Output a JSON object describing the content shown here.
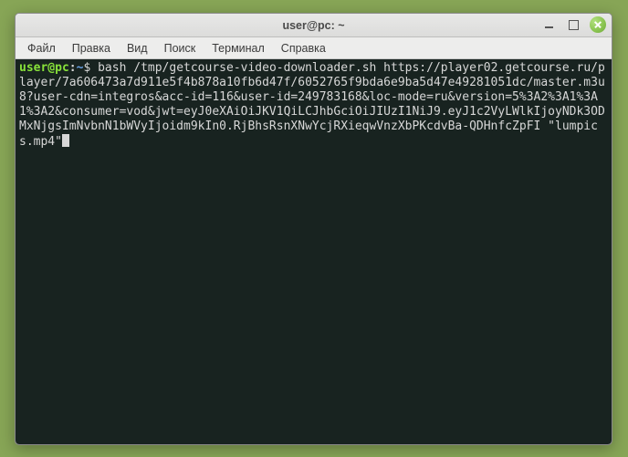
{
  "window": {
    "title": "user@pc: ~"
  },
  "menu": {
    "items": [
      "Файл",
      "Правка",
      "Вид",
      "Поиск",
      "Терминал",
      "Справка"
    ]
  },
  "prompt": {
    "user": "user@pc",
    "colon": ":",
    "path": "~",
    "dollar": "$ "
  },
  "terminal": {
    "command": "bash /tmp/getcourse-video-downloader.sh https://player02.getcourse.ru/player/7a606473a7d911e5f4b878a10fb6d47f/6052765f9bda6e9ba5d47e49281051dc/master.m3u8?user-cdn=integros&acc-id=116&user-id=249783168&loc-mode=ru&version=5%3A2%3A1%3A1%3A2&consumer=vod&jwt=eyJ0eXAiOiJKV1QiLCJhbGciOiJIUzI1NiJ9.eyJ1c2VyLWlkIjoyNDk3ODMxNjgsImNvbnN1bWVyIjoidm9kIn0.RjBhsRsnXNwYcjRXieqwVnzXbPKcdvBa-QDHnfcZpFI \"lumpics.mp4\""
  }
}
